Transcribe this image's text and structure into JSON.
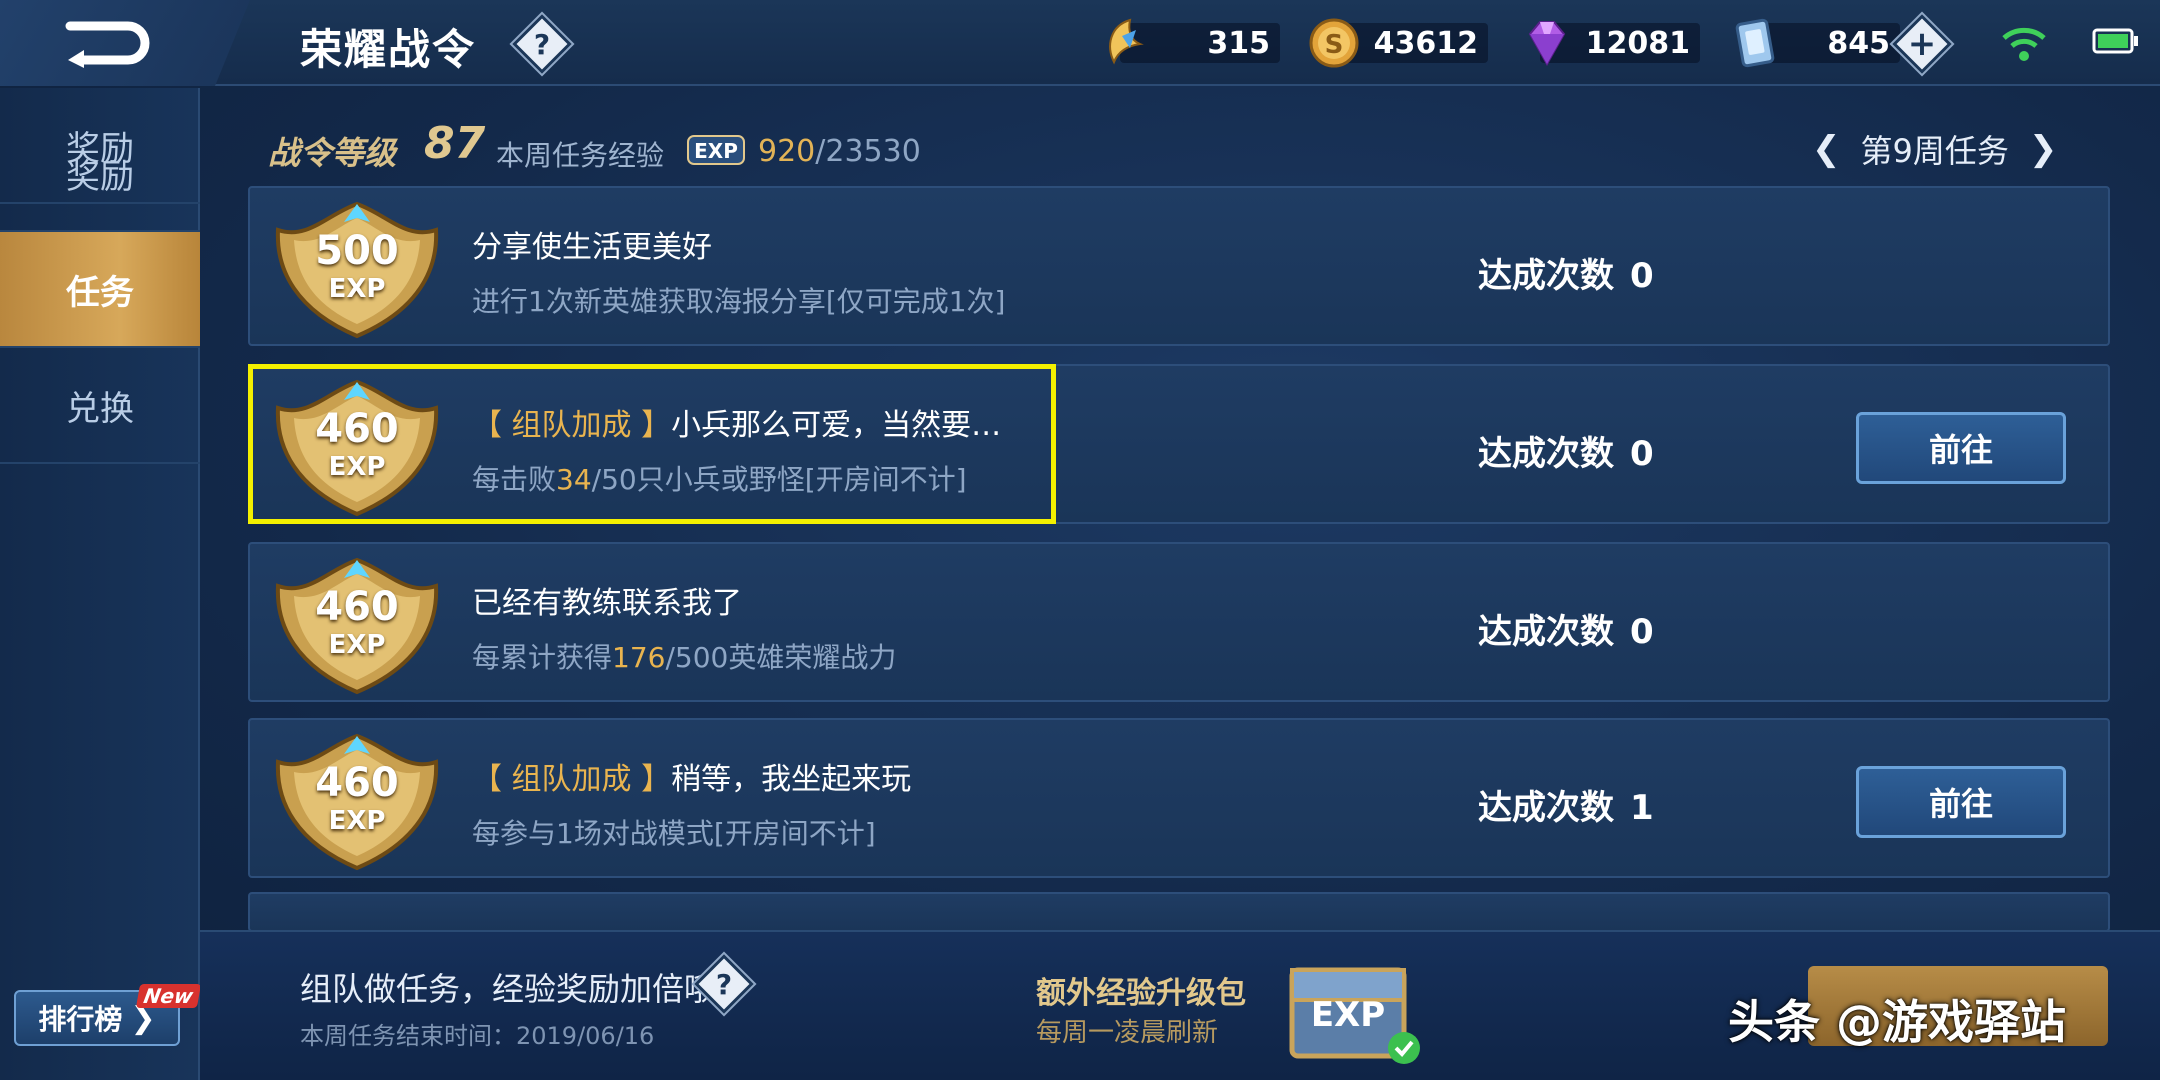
{
  "header": {
    "title": "荣耀战令",
    "help": "?",
    "currencies": [
      {
        "name": "coupon",
        "value": "315"
      },
      {
        "name": "gold-coin",
        "value": "43612"
      },
      {
        "name": "diamond",
        "value": "12081"
      },
      {
        "name": "voucher",
        "value": "845"
      }
    ],
    "add": "+"
  },
  "sidebar": {
    "items": [
      {
        "label": "奖励"
      },
      {
        "label": "任务"
      },
      {
        "label": "兑换"
      }
    ],
    "rank_button": "排行榜",
    "new_badge": "New"
  },
  "pass": {
    "level_label": "战令等级",
    "level": "87",
    "week_exp_label": "本周任务经验",
    "exp_icon_text": "EXP",
    "week_exp_current": "920",
    "week_exp_total": "/23530",
    "week_label": "第9周任务"
  },
  "tasks": [
    {
      "exp": "500",
      "exp_unit": "EXP",
      "tag": "",
      "title": "分享使生活更美好",
      "desc_pre": "进行1次新英雄获取海报分享[仅可完成1次]",
      "desc_hl": "",
      "desc_post": "",
      "count_label": "达成次数",
      "count": "0",
      "button": ""
    },
    {
      "exp": "460",
      "exp_unit": "EXP",
      "tag": "【 组队加成 】",
      "title": "小兵那么可爱，当然要…",
      "desc_pre": "每击败",
      "desc_hl": "34",
      "desc_post": "/50只小兵或野怪[开房间不计]",
      "count_label": "达成次数",
      "count": "0",
      "button": "前往"
    },
    {
      "exp": "460",
      "exp_unit": "EXP",
      "tag": "",
      "title": "已经有教练联系我了",
      "desc_pre": "每累计获得",
      "desc_hl": "176",
      "desc_post": "/500英雄荣耀战力",
      "count_label": "达成次数",
      "count": "0",
      "button": ""
    },
    {
      "exp": "460",
      "exp_unit": "EXP",
      "tag": "【 组队加成 】",
      "title": "稍等，我坐起来玩",
      "desc_pre": "每参与1场对战模式[开房间不计]",
      "desc_hl": "",
      "desc_post": "",
      "count_label": "达成次数",
      "count": "1",
      "button": "前往"
    }
  ],
  "footer": {
    "team_tip": "组队做任务，经验奖励加倍哦",
    "end_time": "本周任务结束时间：2019/06/16",
    "pack_title": "额外经验升级包",
    "pack_sub": "每周一凌晨刷新",
    "chest_text": "EXP"
  },
  "watermark": "头条 @游戏驿站",
  "colors": {
    "accent_gold": "#e9b44f",
    "highlight": "#f4f000",
    "panel": "#1f3c63"
  }
}
